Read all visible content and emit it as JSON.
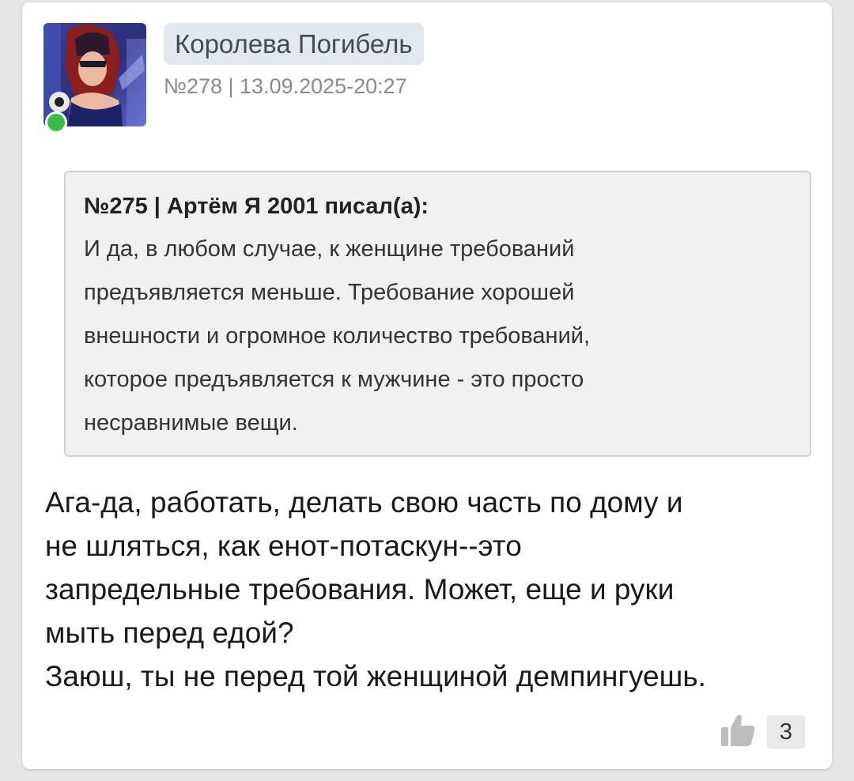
{
  "post": {
    "author": "Королева Погибель",
    "meta": "№278 | 13.09.2025-20:27",
    "quote": {
      "header": "№275 | Артём Я 2001 писал(а):",
      "lines": [
        "И да, в любом случае, к женщине требований",
        "предъявляется меньше. Требование хорошей",
        "внешности и огромное количество требований,",
        "которое предъявляется к мужчине - это просто",
        "несравнимые вещи."
      ]
    },
    "message_lines": [
      "Ага-да, работать, делать свою часть по дому и",
      "не шляться, как енот-потаскун--это",
      "запредельные требования. Может, еще и руки",
      "мыть перед едой?",
      "Заюш, ты не перед той женщиной демпингуешь."
    ],
    "likes": "3"
  },
  "icons": {
    "avatar": "avatar-image",
    "status": "online-status-dot",
    "like": "thumbs-up-icon"
  },
  "colors": {
    "online": "#3dbb4a",
    "username_bg": "#e3e8ee",
    "quote_bg": "#f1f1f1"
  }
}
